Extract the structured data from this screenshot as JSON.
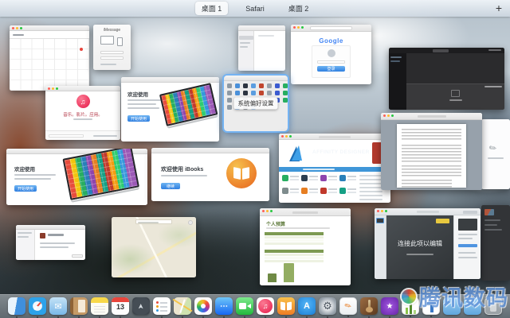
{
  "mission_control": {
    "spaces": [
      {
        "label": "桌面 1",
        "active": true
      },
      {
        "label": "Safari",
        "active": false
      },
      {
        "label": "桌面 2",
        "active": false
      }
    ],
    "add_space_label": "+"
  },
  "windows": {
    "imessage": {
      "title": "iMessage"
    },
    "system_preferences": {
      "tooltip": "系统偏好设置"
    },
    "safari_google": {
      "logo": "Google",
      "signin_button": "登录"
    },
    "itunes": {
      "tagline": "音乐。影片。应用。"
    },
    "photos_welcome_top": {
      "heading": "欢迎使用",
      "button": "开始使用"
    },
    "photos_welcome_bottom": {
      "heading": "欢迎使用",
      "button": "开始使用"
    },
    "ibooks": {
      "heading": "欢迎使用 iBooks",
      "button": "继续"
    },
    "app_store": {
      "banner_title": "AFFINITY DESIGNER"
    },
    "numbers": {
      "sheet_title": "个人预算"
    },
    "keynote": {
      "slide_title": "连接此项以编辑"
    }
  },
  "dock": {
    "calendar_day": "13",
    "items": [
      "finder",
      "safari",
      "mail",
      "contacts",
      "notes",
      "calendar",
      "launchpad",
      "reminders",
      "maps",
      "photos",
      "messages",
      "facetime",
      "itunes",
      "ibooks",
      "app-store",
      "system-preferences",
      "pages",
      "garageband",
      "imovie",
      "numbers",
      "keynote",
      "downloads-folder",
      "documents-folder",
      "trash"
    ]
  },
  "watermark": {
    "text": "腾讯数码"
  }
}
